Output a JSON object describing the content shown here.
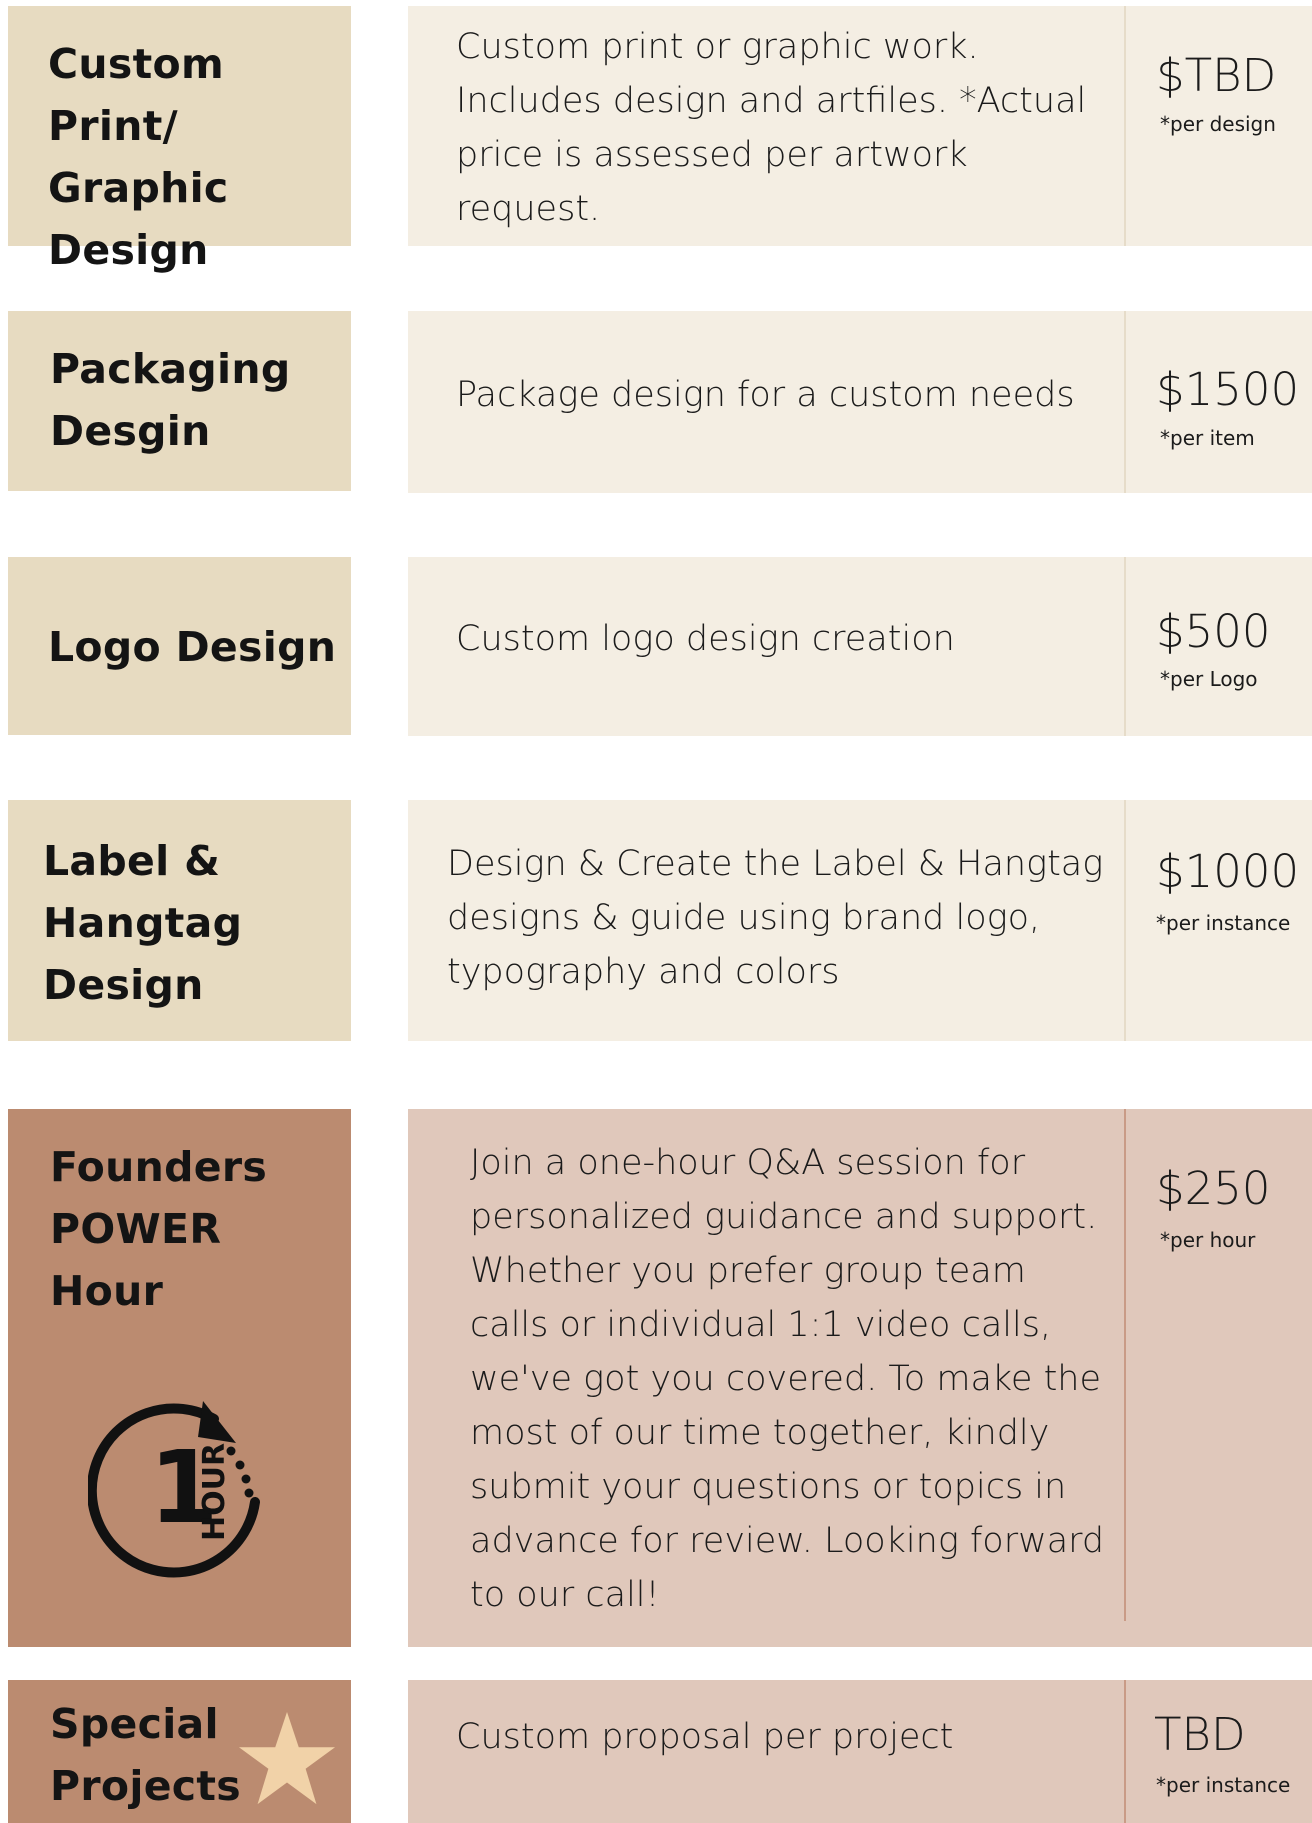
{
  "colors": {
    "title_light": "#e7dbc1",
    "content_light": "#f4eee3",
    "title_dark": "#bb8b70",
    "content_dark": "#e0c8bb",
    "star": "#f1d2a8"
  },
  "services": [
    {
      "title": "Custom Print/\nGraphic\nDesign",
      "description": "Custom print or graphic work. Includes design and artfiles. *Actual price is assessed per artwork request.",
      "price": "$TBD",
      "unit": "*per design"
    },
    {
      "title": "Packaging\nDesgin",
      "description": "Package design for a custom needs",
      "price": "$1500",
      "unit": "*per item"
    },
    {
      "title": "Logo Design",
      "description": "Custom logo design creation",
      "price": "$500",
      "unit": "*per Logo"
    },
    {
      "title": "Label &\nHangtag\nDesign",
      "description": "Design & Create the Label & Hangtag designs & guide using brand logo, typography and colors",
      "price": "$1000",
      "unit": "*per instance"
    },
    {
      "title": "Founders\nPOWER\nHour",
      "description": "Join a one-hour Q&A session for personalized guidance and support. Whether you prefer group team calls or individual 1:1 video calls, we've got you covered. To make the most of our time together, kindly submit your questions or topics in advance for review. Looking forward to our call!",
      "price": "$250",
      "unit": "*per hour",
      "icon": "one-hour-clock-icon",
      "icon_text": {
        "number": "1",
        "word": "HOUR"
      }
    },
    {
      "title": "Special\nProjects",
      "description": "Custom proposal per project",
      "price": "TBD",
      "unit": "*per instance",
      "icon": "star-icon"
    }
  ]
}
